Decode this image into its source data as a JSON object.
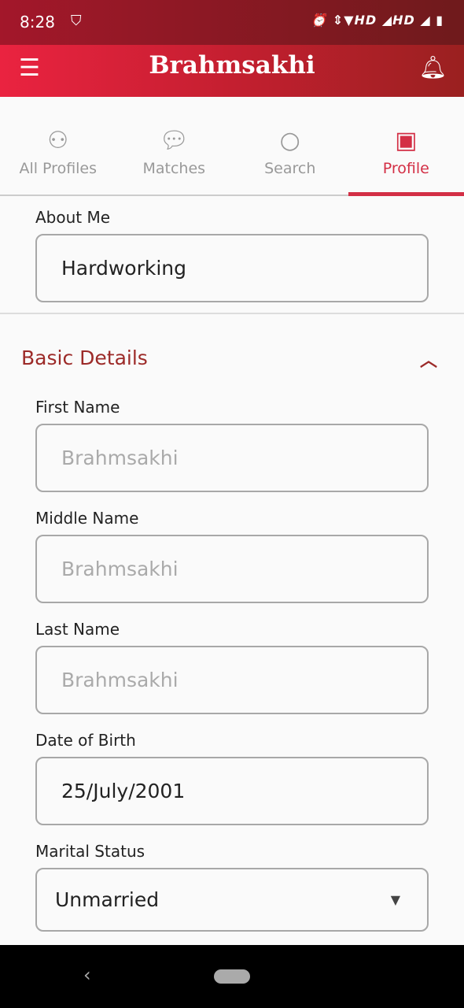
{
  "status_bar": {
    "time": "8:28",
    "right": "⏰ ⇕▼HD ◢HD ◢ ▮"
  },
  "app_bar": {
    "title": "Brahmsakhi"
  },
  "tabs": [
    {
      "label": "All Profiles",
      "icon": "users-icon"
    },
    {
      "label": "Matches",
      "icon": "heart-chat-icon"
    },
    {
      "label": "Search",
      "icon": "search-heart-icon"
    },
    {
      "label": "Profile",
      "icon": "profile-icon",
      "active": true
    }
  ],
  "about": {
    "label": "About Me",
    "value": "Hardworking"
  },
  "basic_details": {
    "title": "Basic Details",
    "expanded": true,
    "first_name": {
      "label": "First Name",
      "placeholder": "Brahmsakhi"
    },
    "middle_name": {
      "label": "Middle Name",
      "placeholder": "Brahmsakhi"
    },
    "last_name": {
      "label": "Last Name",
      "placeholder": "Brahmsakhi"
    },
    "dob": {
      "label": "Date of Birth",
      "value": "25/July/2001"
    },
    "marital_status": {
      "label": "Marital Status",
      "value": "Unmarried"
    }
  },
  "colors": {
    "accent": "#d32f45",
    "section": "#9c2a28"
  }
}
